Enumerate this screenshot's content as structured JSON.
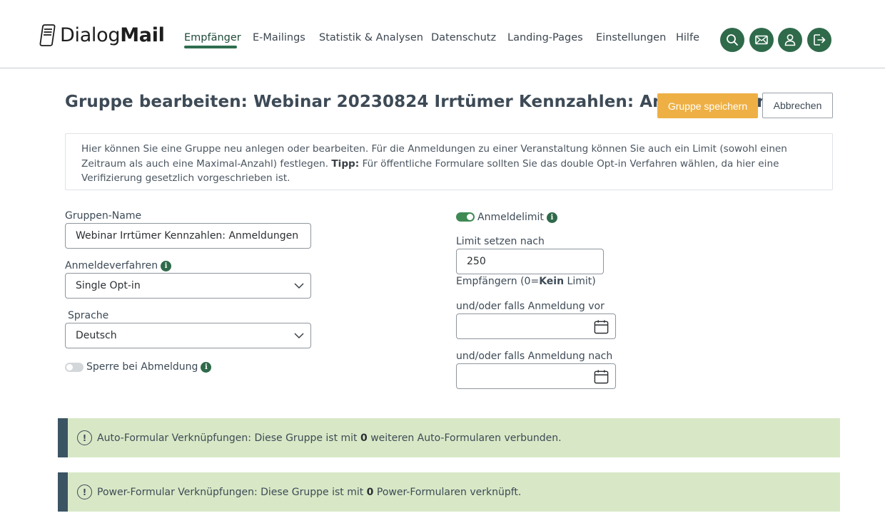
{
  "brand": {
    "logo_light": "Dialog",
    "logo_bold": "Mail"
  },
  "nav": {
    "items": [
      {
        "label": "Empfänger",
        "active": true
      },
      {
        "label": "E-Mailings"
      },
      {
        "label": "Statistik & Analysen"
      },
      {
        "label": "Datenschutz"
      },
      {
        "label": "Landing-Pages"
      },
      {
        "label": "Einstellungen"
      },
      {
        "label": "Hilfe"
      }
    ],
    "icons": [
      "search-icon",
      "mail-icon",
      "user-icon",
      "logout-icon"
    ]
  },
  "page": {
    "title": "Gruppe bearbeiten: Webinar 20230824 Irrtümer Kennzahlen: Anmeldungen",
    "save_label": "Gruppe speichern",
    "cancel_label": "Abbrechen"
  },
  "info": {
    "text": "Hier können Sie eine Gruppe neu anlegen oder bearbeiten. Für die Anmeldungen zu einer Veranstaltung können Sie auch ein Limit (sowohl einen Zeitraum als auch eine Maximal-Anzahl) festlegen.",
    "tip_label": "Tipp:",
    "tip_text": "Für öffentliche Formulare sollten Sie das double Opt-in Verfahren wählen, da hier eine Verifizierung gesetzlich vorgeschrieben ist."
  },
  "form": {
    "group_name_label": "Gruppen-Name",
    "group_name_value": "Webinar Irrtümer Kennzahlen: Anmeldungen",
    "procedure_label": "Anmeldeverfahren",
    "procedure_value": "Single Opt-in",
    "language_label": "Sprache",
    "language_value": "Deutsch",
    "lock_label": "Sperre bei Abmeldung",
    "lock_enabled": false,
    "limit_toggle_label": "Anmeldelimit",
    "limit_enabled": true,
    "limit_label": "Limit setzen nach",
    "limit_value": "250",
    "limit_hint_prefix": "Empfängern (0=",
    "limit_hint_bold": "Kein",
    "limit_hint_suffix": " Limit)",
    "before_label": "und/oder falls Anmeldung vor",
    "before_value": "",
    "after_label": "und/oder falls Anmeldung nach",
    "after_value": ""
  },
  "alerts": [
    {
      "prefix": "Auto-Formular Verknüpfungen: Diese Gruppe ist mit ",
      "count": "0",
      "suffix": " weiteren Auto-Formularen verbunden."
    },
    {
      "prefix": "Power-Formular Verknüpfungen: Diese Gruppe ist mit ",
      "count": "0",
      "suffix": " Power-Formularen verknüpft."
    }
  ],
  "colors": {
    "primary": "#2f6a4a",
    "accent": "#eeb045",
    "alert_bg": "#d8e8c6",
    "alert_bar": "#3b5464"
  }
}
